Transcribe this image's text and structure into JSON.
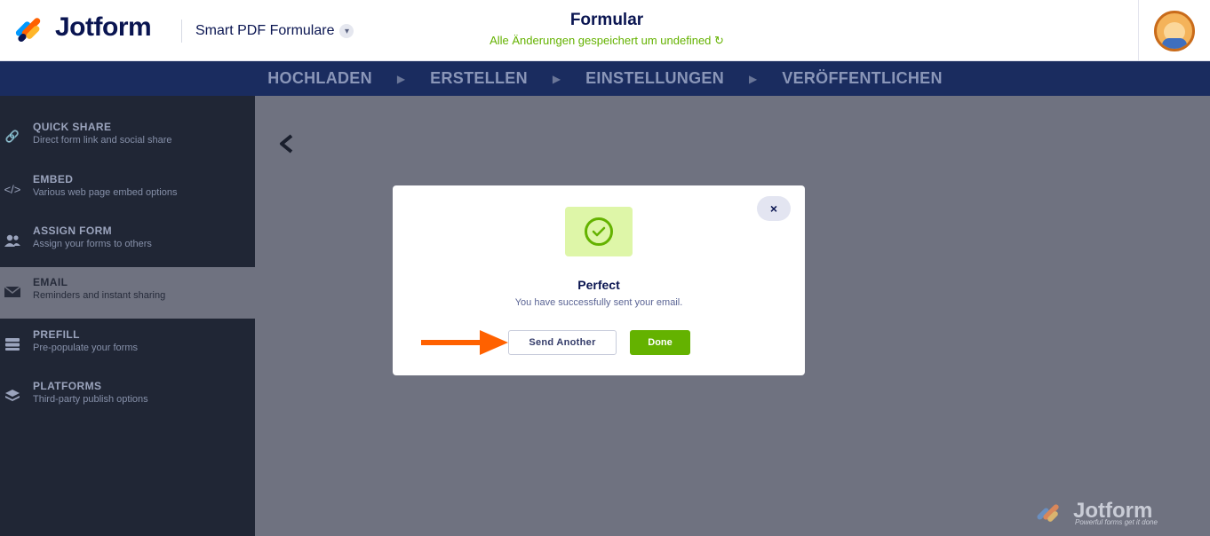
{
  "header": {
    "logo_text": "Jotform",
    "product_name": "Smart PDF Formulare",
    "form_title": "Formular",
    "saved_status": "Alle Änderungen gespeichert um undefined"
  },
  "nav": {
    "steps": [
      "HOCHLADEN",
      "ERSTELLEN",
      "EINSTELLUNGEN",
      "VERÖFFENTLICHEN"
    ]
  },
  "sidebar": {
    "items": [
      {
        "title": "QUICK SHARE",
        "subtitle": "Direct form link and social share",
        "icon": "link-icon"
      },
      {
        "title": "EMBED",
        "subtitle": "Various web page embed options",
        "icon": "code-icon"
      },
      {
        "title": "ASSIGN FORM",
        "subtitle": "Assign your forms to others",
        "icon": "users-icon"
      },
      {
        "title": "EMAIL",
        "subtitle": "Reminders and instant sharing",
        "icon": "envelope-icon",
        "active": true
      },
      {
        "title": "PREFILL",
        "subtitle": "Pre-populate your forms",
        "icon": "prefill-icon"
      },
      {
        "title": "PLATFORMS",
        "subtitle": "Third-party publish options",
        "icon": "layers-icon"
      }
    ]
  },
  "modal": {
    "title": "Perfect",
    "message": "You have successfully sent your email.",
    "send_another_label": "Send Another",
    "done_label": "Done",
    "close_symbol": "×"
  },
  "watermark": {
    "brand": "Jotform",
    "tagline": "Powerful forms get it done"
  },
  "colors": {
    "navy": "#0a1551",
    "green": "#64b200",
    "nav_bg": "#1a2c5f",
    "sidebar_bg": "#202635",
    "overlay": "#6f7280",
    "arrow": "#ff6100"
  }
}
